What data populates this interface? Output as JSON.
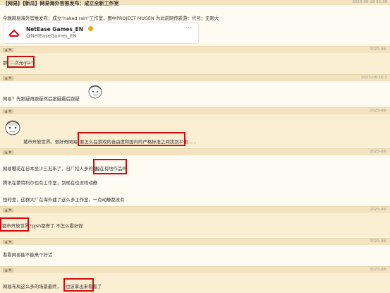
{
  "post": {
    "title": "【网易】【新瓜】网易海外官推发布：成立全新工作室",
    "timestamp": "2023-08-16 02:38",
    "text": "今晚网易海外官推发布：成立\"naked rain\"工作室，图中PROJECT MUGEN 为此前网传新游：代号：无限大"
  },
  "tweet_card": {
    "name": "NetEase Games_EN",
    "handle": "@NetEaseGames_EN",
    "more": "···"
  },
  "replies": [
    {
      "time": "2023-08-",
      "text": "那",
      "highlight": "二次元gta？"
    },
    {
      "time": "2023-08-16 0",
      "text": "网易？先跟疑再跟疑然后跟疑最后跟疑"
    },
    {
      "time": "2023-08-",
      "prefix": "城市开放世界。很好奇网易",
      "highlight": "要怎么在游戏的自由度和国内的严格标准之间找到平衡......"
    },
    {
      "time": "2023-08-",
      "line1_prefix": "网易樱花在日本至少三五年了，日厂挖人多的是，",
      "line1_highlight": "现在有啥作品吗",
      "line2": "腾讯在蒙特利尔也有工作室，到现在也没啥动静",
      "line3": "怪的是，这群大厂在海外建了这么多工作室，一点动静都没有"
    },
    {
      "time": "2023-08-",
      "highlight": "都市开放世界？",
      "text": "pjsh都寄了 不怎么看好捏"
    },
    {
      "time": "2023-08-",
      "text": "看看网易能不能来个好活"
    },
    {
      "time": "2023-08-",
      "prefix": "网易布局这么多的场景最终，",
      "highlight": "也该拿出来看看了"
    }
  ],
  "colors": {
    "highlight_border": "#d10a10",
    "bar": "#f3e3c1",
    "brand_red": "#d7000f"
  },
  "icons": [
    "thumb-icon",
    "verified-badge-icon",
    "more-icon",
    "netease-logo-icon",
    "anime-sticker-icon"
  ]
}
